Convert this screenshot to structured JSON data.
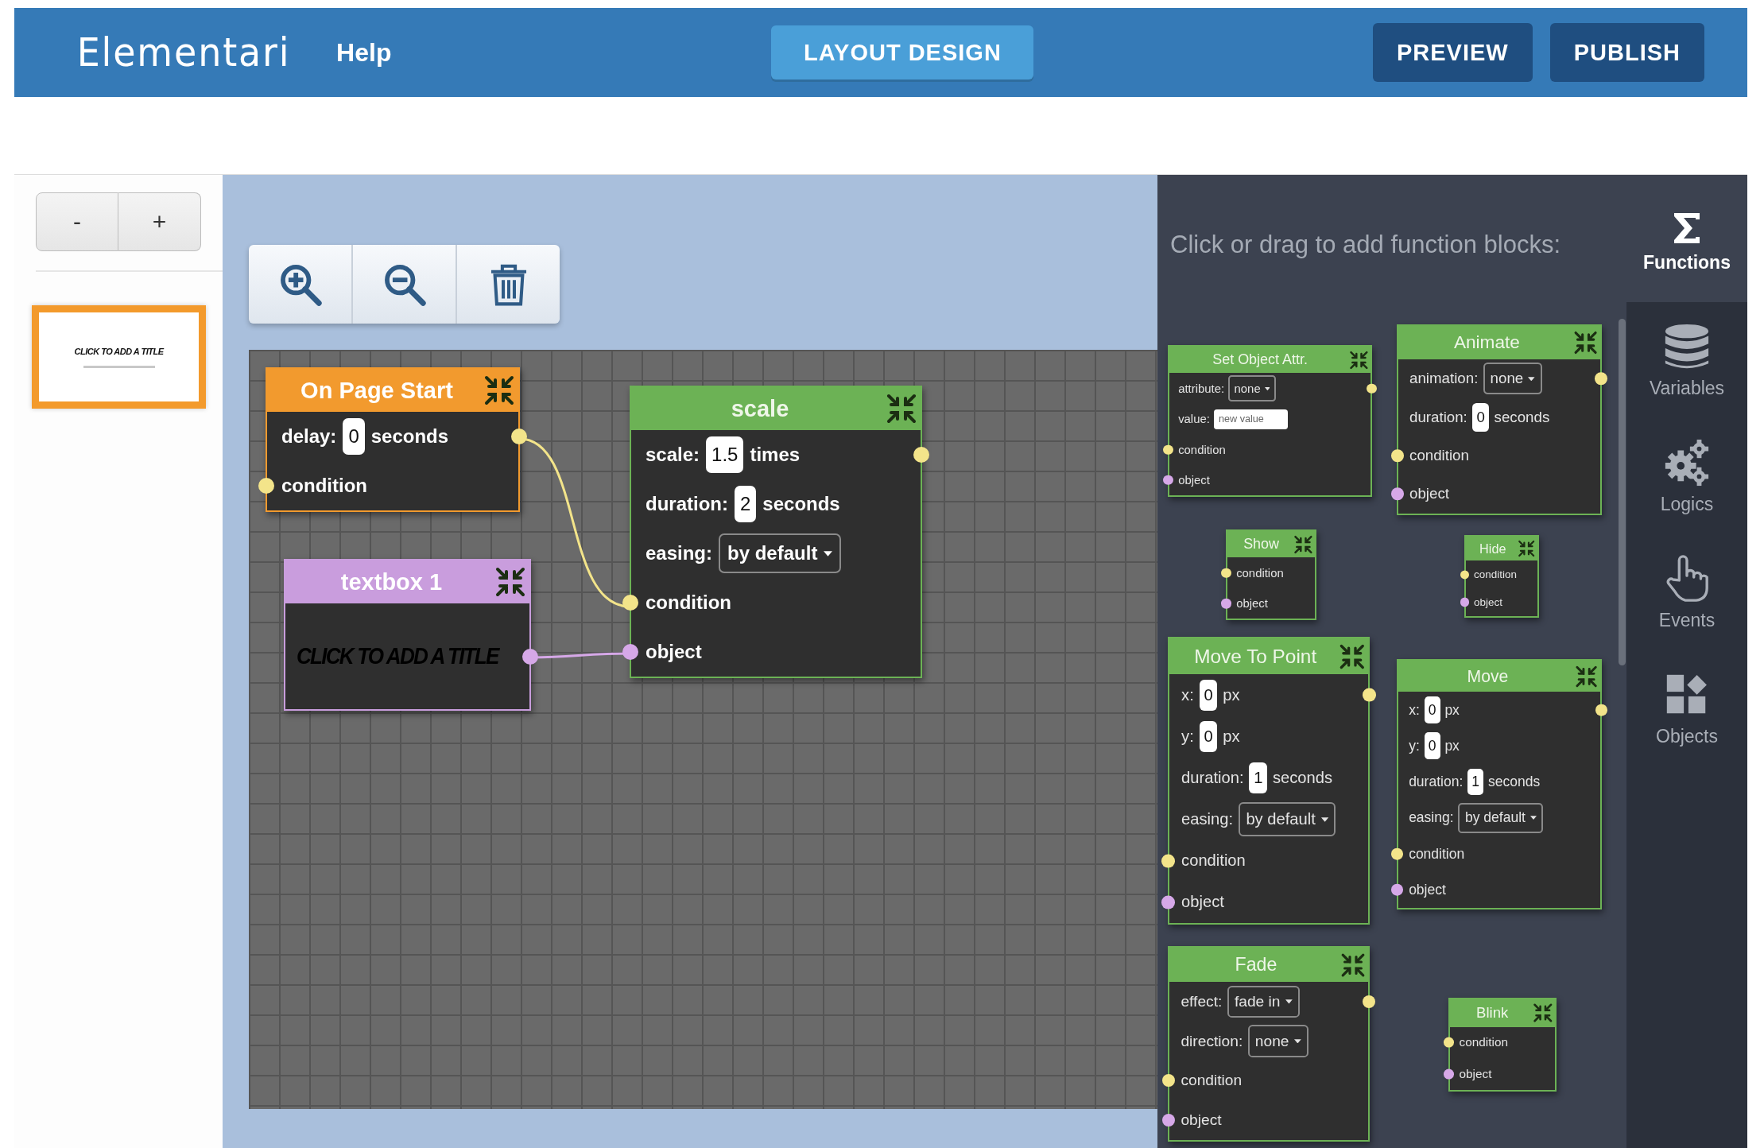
{
  "header": {
    "logo": "Elementari",
    "help": "Help",
    "mode_button": "LAYOUT DESIGN",
    "buttons": [
      "PREVIEW",
      "PUBLISH"
    ]
  },
  "pages_panel": {
    "zoom_buttons": [
      "-",
      "+"
    ],
    "pages": [
      {
        "title": "CLICK TO ADD A TITLE",
        "selected": true
      }
    ]
  },
  "canvas": {
    "blocks": [
      {
        "title": "On Page Start",
        "kind": "event",
        "color": "#f29a2e",
        "rows": [
          {
            "kind": "number",
            "label": "delay:",
            "value": "0",
            "unit": "seconds",
            "output": true
          },
          {
            "kind": "condition",
            "label": "condition"
          }
        ]
      },
      {
        "title": "textbox 1",
        "kind": "object",
        "color": "#c99ddd",
        "rows": [
          {
            "kind": "title",
            "value": "CLICK TO ADD A TITLE",
            "output": true
          }
        ]
      },
      {
        "title": "scale",
        "kind": "action",
        "color": "#6cb255",
        "rows": [
          {
            "kind": "number",
            "label": "scale:",
            "value": "1.5",
            "unit": "times",
            "output": true
          },
          {
            "kind": "number",
            "label": "duration:",
            "value": "2",
            "unit": "seconds"
          },
          {
            "kind": "select",
            "label": "easing:",
            "value": "by default"
          },
          {
            "kind": "condition",
            "label": "condition"
          },
          {
            "kind": "object",
            "label": "object"
          }
        ]
      }
    ],
    "wires": [
      {
        "kind": "condition"
      },
      {
        "kind": "object"
      }
    ]
  },
  "palette": {
    "prompt": "Click or drag to add function blocks:",
    "blocks": [
      {
        "title": "Set Object Attr.",
        "kind": "action",
        "color": "#6cb255",
        "rows": [
          {
            "kind": "select",
            "label": "attribute:",
            "value": "none",
            "output": true
          },
          {
            "kind": "text",
            "label": "value:",
            "placeholder": "new value"
          },
          {
            "kind": "condition",
            "label": "condition"
          },
          {
            "kind": "object",
            "label": "object"
          }
        ]
      },
      {
        "title": "Animate",
        "kind": "action",
        "color": "#6cb255",
        "rows": [
          {
            "kind": "select",
            "label": "animation:",
            "value": "none",
            "output": true
          },
          {
            "kind": "number",
            "label": "duration:",
            "value": "0",
            "unit": "seconds"
          },
          {
            "kind": "condition",
            "label": "condition"
          },
          {
            "kind": "object",
            "label": "object"
          }
        ]
      },
      {
        "title": "Show",
        "kind": "action",
        "color": "#6cb255",
        "rows": [
          {
            "kind": "condition",
            "label": "condition"
          },
          {
            "kind": "object",
            "label": "object"
          }
        ]
      },
      {
        "title": "Hide",
        "kind": "action",
        "color": "#6cb255",
        "rows": [
          {
            "kind": "condition",
            "label": "condition"
          },
          {
            "kind": "object",
            "label": "object"
          }
        ]
      },
      {
        "title": "Move To Point",
        "kind": "action",
        "color": "#6cb255",
        "rows": [
          {
            "kind": "number",
            "label": "x:",
            "value": "0",
            "unit": "px",
            "output": true
          },
          {
            "kind": "number",
            "label": "y:",
            "value": "0",
            "unit": "px"
          },
          {
            "kind": "number",
            "label": "duration:",
            "value": "1",
            "unit": "seconds"
          },
          {
            "kind": "select",
            "label": "easing:",
            "value": "by default"
          },
          {
            "kind": "condition",
            "label": "condition"
          },
          {
            "kind": "object",
            "label": "object"
          }
        ]
      },
      {
        "title": "Move",
        "kind": "action",
        "color": "#6cb255",
        "rows": [
          {
            "kind": "number",
            "label": "x:",
            "value": "0",
            "unit": "px",
            "output": true
          },
          {
            "kind": "number",
            "label": "y:",
            "value": "0",
            "unit": "px"
          },
          {
            "kind": "number",
            "label": "duration:",
            "value": "1",
            "unit": "seconds"
          },
          {
            "kind": "select",
            "label": "easing:",
            "value": "by default"
          },
          {
            "kind": "condition",
            "label": "condition"
          },
          {
            "kind": "object",
            "label": "object"
          }
        ]
      },
      {
        "title": "Fade",
        "kind": "action",
        "color": "#6cb255",
        "rows": [
          {
            "kind": "select",
            "label": "effect:",
            "value": "fade in",
            "output": true
          },
          {
            "kind": "select",
            "label": "direction:",
            "value": "none"
          },
          {
            "kind": "condition",
            "label": "condition"
          },
          {
            "kind": "object",
            "label": "object"
          }
        ]
      },
      {
        "title": "Blink",
        "kind": "action",
        "color": "#6cb255",
        "rows": [
          {
            "kind": "condition",
            "label": "condition"
          },
          {
            "kind": "object",
            "label": "object"
          }
        ]
      }
    ]
  },
  "sidebar": {
    "tabs": [
      {
        "kind": "functions",
        "label": "Functions",
        "selected": true
      },
      {
        "kind": "variables",
        "label": "Variables",
        "selected": false
      },
      {
        "kind": "logics",
        "label": "Logics",
        "selected": false
      },
      {
        "kind": "events",
        "label": "Events",
        "selected": false
      },
      {
        "kind": "objects",
        "label": "Objects",
        "selected": false
      }
    ]
  }
}
